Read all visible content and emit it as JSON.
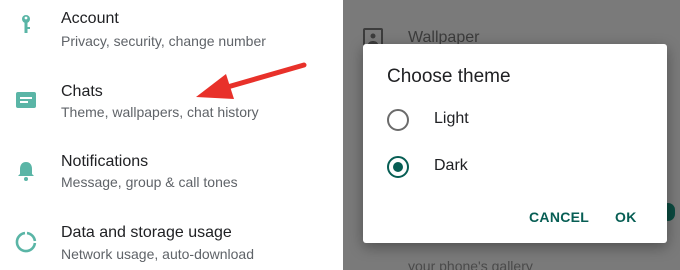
{
  "settings": {
    "items": [
      {
        "title": "Account",
        "subtitle": "Privacy, security, change number",
        "icon": "key-icon"
      },
      {
        "title": "Chats",
        "subtitle": "Theme, wallpapers, chat history",
        "icon": "chat-icon"
      },
      {
        "title": "Notifications",
        "subtitle": "Message, group & call tones",
        "icon": "bell-icon"
      },
      {
        "title": "Data and storage usage",
        "subtitle": "Network usage, auto-download",
        "icon": "data-usage-icon"
      }
    ],
    "icon_color": "#5ab5a6"
  },
  "background_screen": {
    "wallpaper_label": "Wallpaper",
    "gallery_text": "your phone's gallery"
  },
  "dialog": {
    "title": "Choose theme",
    "options": [
      {
        "label": "Light",
        "selected": false
      },
      {
        "label": "Dark",
        "selected": true
      }
    ],
    "cancel_label": "CANCEL",
    "ok_label": "OK",
    "accent_color": "#075e54"
  },
  "annotation": {
    "arrow_color": "#e8312a"
  }
}
